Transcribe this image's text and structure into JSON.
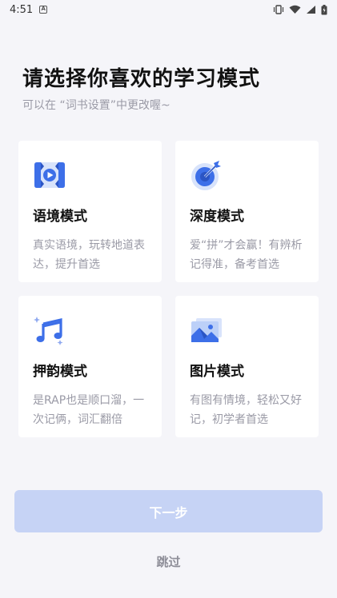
{
  "status_bar": {
    "time": "4:51",
    "badge": "A"
  },
  "header": {
    "title": "请选择你喜欢的学习模式",
    "subtitle": "可以在 “词书设置”中更改喔~"
  },
  "modes": [
    {
      "name": "语境模式",
      "desc": "真实语境，玩转地道表达，提升首选",
      "icon": "video-play-icon"
    },
    {
      "name": "深度模式",
      "desc": "爱“拼”才会赢！有辨析记得准，备考首选",
      "icon": "target-icon"
    },
    {
      "name": "押韵模式",
      "desc": "是RAP也是顺口溜，一次记俩，词汇翻倍",
      "icon": "music-note-icon"
    },
    {
      "name": "图片模式",
      "desc": "有图有情境，轻松又好记，初学者首选",
      "icon": "picture-icon"
    }
  ],
  "actions": {
    "next_label": "下一步",
    "skip_label": "跳过"
  },
  "colors": {
    "accent": "#3d6fe8",
    "button_disabled": "#c6d3f5",
    "background": "#f5f5f9"
  }
}
